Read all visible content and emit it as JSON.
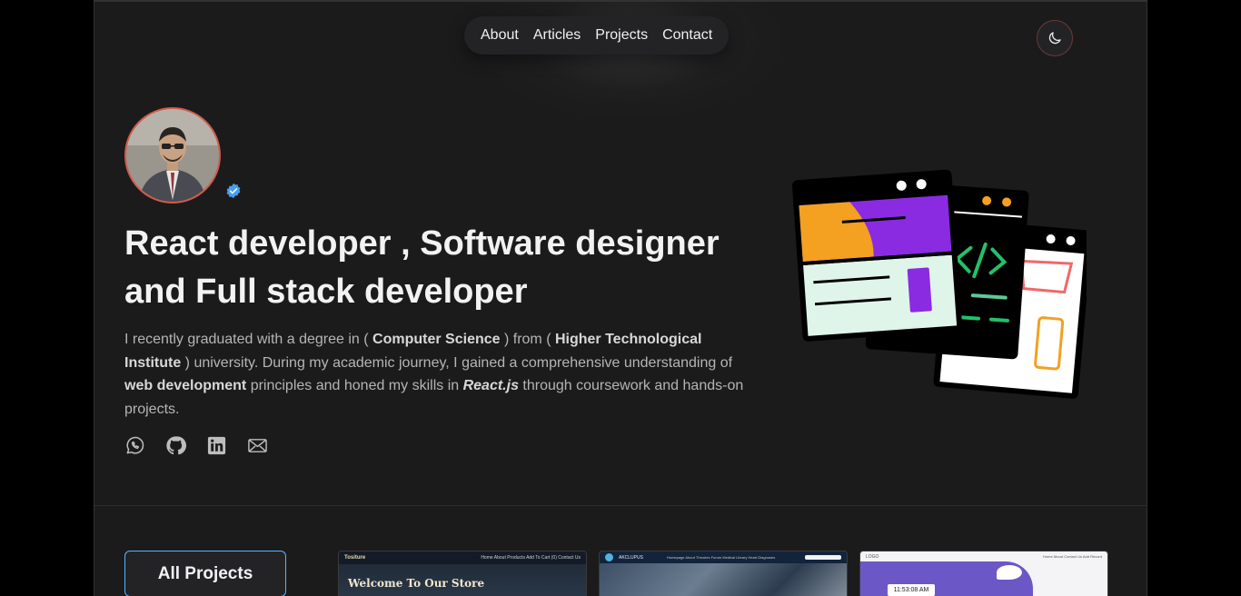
{
  "nav": {
    "items": [
      "About",
      "Articles",
      "Projects",
      "Contact"
    ]
  },
  "theme_toggle": {
    "icon": "moon-icon"
  },
  "hero": {
    "headline": "React developer , Software designer and Full stack developer",
    "bio": {
      "t1": "I recently graduated with a degree in ( ",
      "b1": "Computer Science",
      "t2": " ) from ( ",
      "b2": "Higher Technological Institute",
      "t3": " ) university. During my academic journey, I gained a comprehensive understanding of ",
      "b3": "web development",
      "t4": " principles and honed my skills in ",
      "b4": "React.js",
      "t5": " through coursework and hands-on projects."
    },
    "socials": [
      "whatsapp-icon",
      "github-icon",
      "linkedin-icon",
      "mail-icon"
    ]
  },
  "projects": {
    "all_button": "All Projects",
    "cards": [
      {
        "brand": "Tositure",
        "links": "Home  About  Products  Add To Cart (0)  Contact Us",
        "title": "Welcome To Our Store"
      },
      {
        "brand": "AKCLUPUS",
        "links": "Homepage  About  Theories  Forum  Medical Library  Heart Diagnoses"
      },
      {
        "logo": "LOGO",
        "links": "Home  About  Contact Us  Add Record",
        "clock": "11:53:08 AM"
      }
    ]
  },
  "colors": {
    "background": "#1b1b1c",
    "accent_border": "#5ab2ff",
    "avatar_ring": "#d25a4c",
    "verified": "#4a9ff0"
  }
}
